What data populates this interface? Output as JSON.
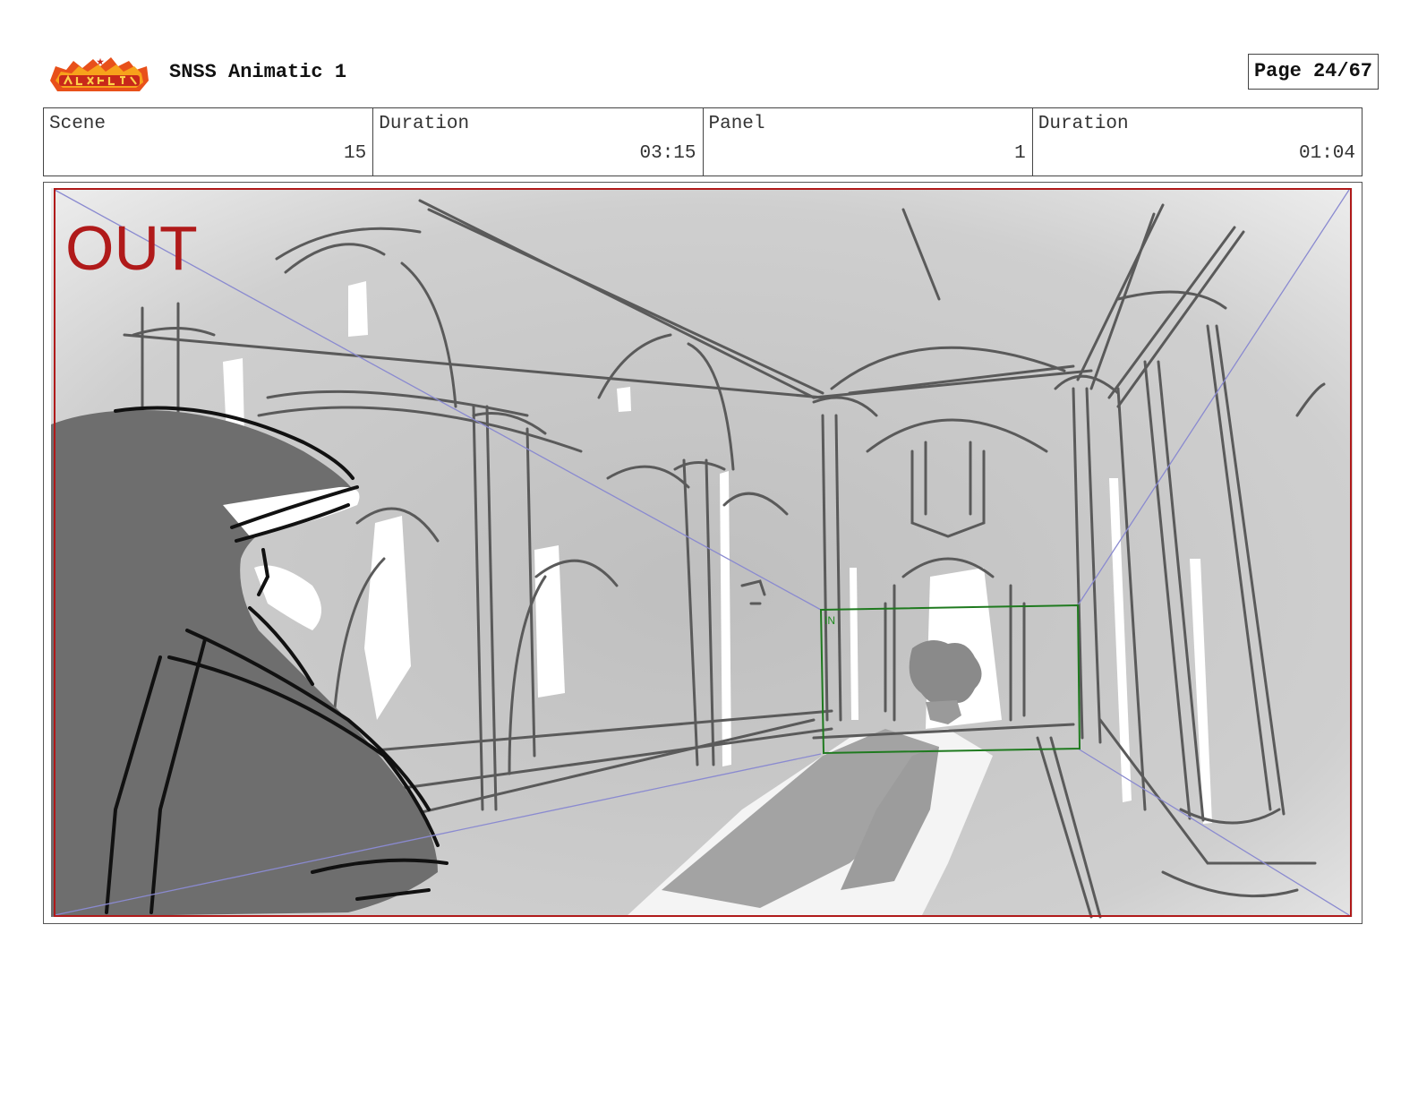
{
  "header": {
    "logo_icon": "show-logo-icon",
    "title": "SNSS Animatic 1",
    "page": "Page 24/67"
  },
  "info": {
    "scene_label": "Scene",
    "scene_value": "15",
    "scene_duration_label": "Duration",
    "scene_duration_value": "03:15",
    "panel_label": "Panel",
    "panel_value": "1",
    "panel_duration_label": "Duration",
    "panel_duration_value": "01:04"
  },
  "panel": {
    "out_label": "OUT",
    "in_label": "IN",
    "out_color": "#b01a1a",
    "in_color": "#1f8a1f",
    "guide_color": "#8a8ad0"
  }
}
